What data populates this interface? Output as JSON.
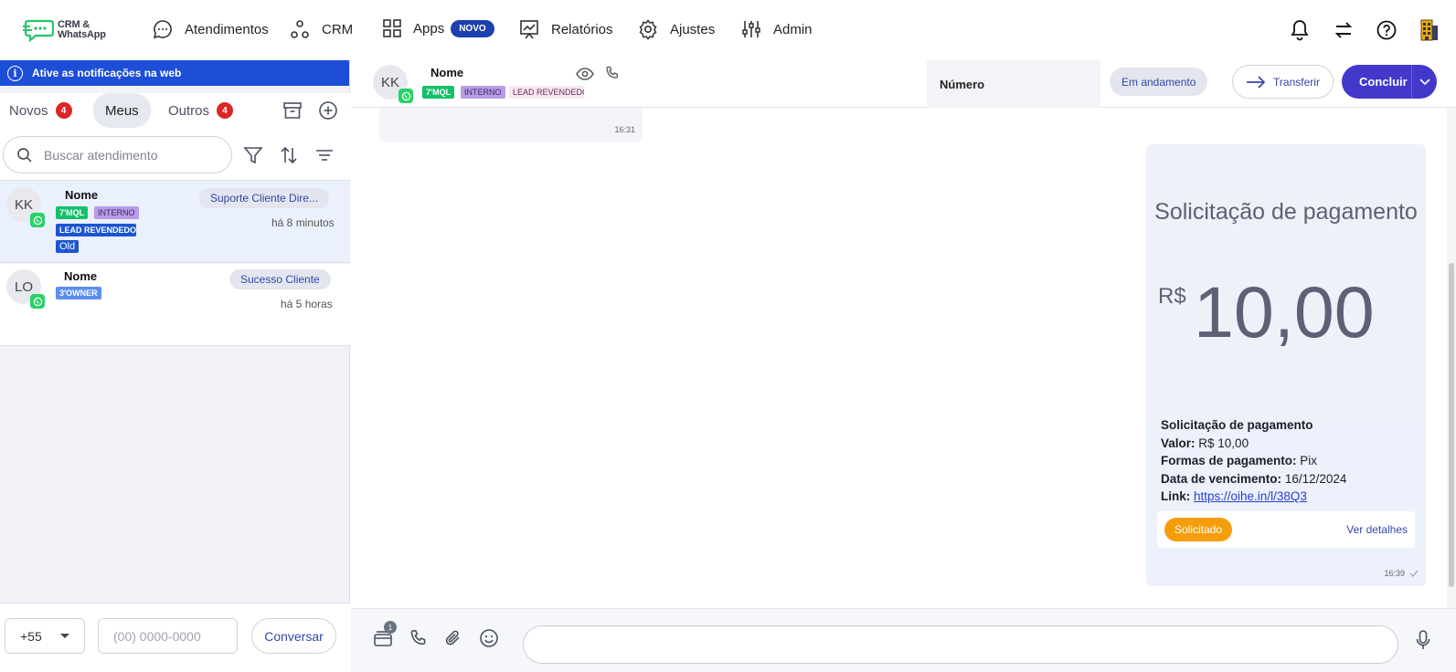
{
  "nav": {
    "logo_line1": "CRM &",
    "logo_line2": "WhatsApp",
    "items": [
      {
        "label": "Atendimentos",
        "icon": "chat-bubble-icon"
      },
      {
        "label": "CRM",
        "icon": "crm-nodes-icon"
      },
      {
        "label": "Apps",
        "icon": "apps-grid-icon",
        "badge": "NOVO"
      },
      {
        "label": "Relatórios",
        "icon": "report-chart-icon"
      },
      {
        "label": "Ajustes",
        "icon": "gear-icon"
      },
      {
        "label": "Admin",
        "icon": "sliders-icon"
      }
    ],
    "right_icons": [
      "bell-icon",
      "transfer-arrows-icon",
      "help-icon",
      "building-icon"
    ]
  },
  "left_panel": {
    "notification_banner": "Ative as notificações na web",
    "tabs": [
      {
        "label": "Novos",
        "count": "4"
      },
      {
        "label": "Meus",
        "count": ""
      },
      {
        "label": "Outros",
        "count": "4"
      }
    ],
    "search_placeholder": "Buscar atendimento",
    "conversations": [
      {
        "initials": "KK",
        "name": "Nome",
        "tags": [
          "7'MQL",
          "INTERNO",
          "LEAD REVENDEDOR",
          "Old"
        ],
        "queue": "Suporte Cliente Dire...",
        "time": "há 8 minutos",
        "selected": true
      },
      {
        "initials": "LO",
        "name": "Nome",
        "tags": [
          "3'OWNER"
        ],
        "queue": "Sucesso Cliente",
        "time": "há 5 horas",
        "selected": false
      }
    ],
    "footer": {
      "ddi": "+55",
      "phone_placeholder": "(00) 0000-0000",
      "button": "Conversar"
    }
  },
  "chat_header": {
    "initials": "KK",
    "name": "Nome",
    "tags": [
      "7'MQL",
      "INTERNO",
      "LEAD REVENDEDOR"
    ],
    "number_label": "Número",
    "status": "Em andamento",
    "transfer_label": "Transferir",
    "conclude_label": "Concluir"
  },
  "messages": {
    "previous_time": "16:31",
    "payment": {
      "image_title": "Solicitação de pagamento",
      "image_currency": "R$",
      "image_amount": "10,00",
      "heading": "Solicitação de pagamento",
      "valor_label": "Valor:",
      "valor": "R$ 10,00",
      "formas_label": "Formas de pagamento:",
      "formas": "Pix",
      "vencimento_label": "Data de vencimento:",
      "vencimento": "16/12/2024",
      "link_label": "Link:",
      "link": "https://oihe.in/l/38Q3",
      "status": "Solicitado",
      "details_link": "Ver detalhes",
      "time": "16:39"
    }
  },
  "composer": {
    "template_badge": "1"
  },
  "colors": {
    "primary": "#4338ca",
    "banner": "#1d4ed8",
    "badge_red": "#dc2626",
    "whatsapp": "#25d366",
    "status_orange": "#f59e0b"
  }
}
